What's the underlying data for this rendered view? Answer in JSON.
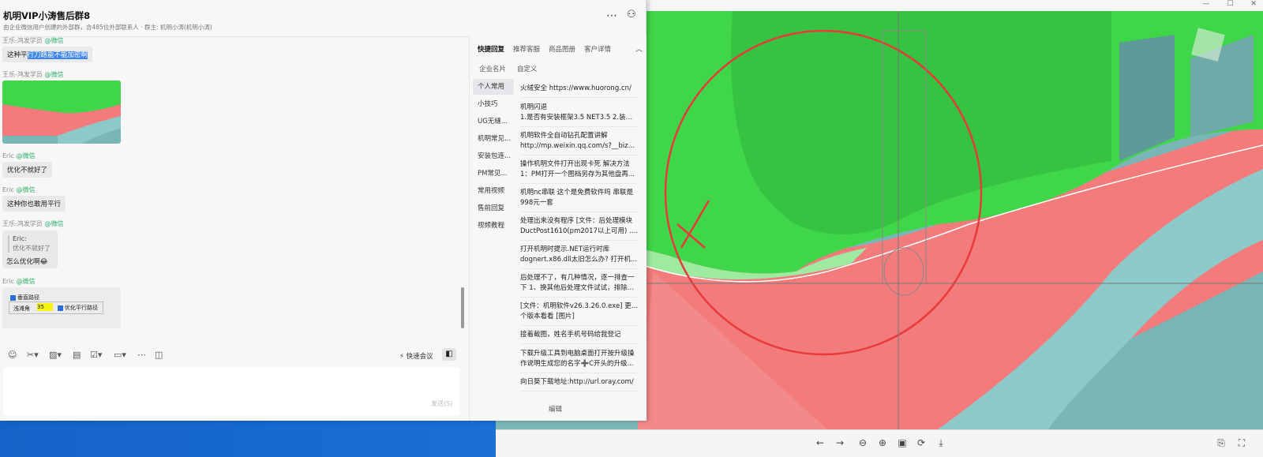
{
  "chat": {
    "title": "机明VIP小涛售后群8",
    "subtitle": "由企业微信用户创建的外部群，含485位外部联系人 · 群主: 机明小涛(机明小涛)",
    "messages": [
      {
        "sender": "王乐-鸿发学员",
        "source": "@微信",
        "text_pre": "这种平",
        "text_hl": "行刀路能不能加密啊"
      },
      {
        "sender": "王乐-鸿发学员",
        "source": "@微信",
        "type": "image"
      },
      {
        "sender": "Eric",
        "source": "@微信",
        "text": "优化不就好了"
      },
      {
        "sender": "Eric",
        "source": "@微信",
        "text": "这种你也敢用平行"
      },
      {
        "sender": "王乐-鸿发学员",
        "source": "@微信",
        "quote_name": "Eric:",
        "quote_text": "优化不就好了",
        "text": "怎么优化啊😂"
      },
      {
        "sender": "Eric",
        "source": "@微信",
        "type": "image",
        "img": {
          "check1": "垂直路径",
          "label": "浅滩角",
          "value": "35",
          "check2": "优化平行路径"
        }
      }
    ],
    "toolbar": {
      "quick_meeting": "快速会议"
    },
    "send_label": "发送(S)"
  },
  "panel": {
    "tabs": [
      "快捷回复",
      "推荐客服",
      "商品图册",
      "客户详情"
    ],
    "subtabs": [
      "企业名片",
      "自定义"
    ],
    "categories": [
      "个人常用",
      "小技巧",
      "UG无缝...",
      "机明常见...",
      "安装包连...",
      "PM常见...",
      "常用视频",
      "售前回复",
      "视频教程"
    ],
    "replies": [
      [
        "火绒安全  https://www.huorong.cn/"
      ],
      [
        "机明闪退",
        "1.是否有安装框架3.5 NET3.5 2.装了要..."
      ],
      [
        "机明软件全自动钻孔配置讲解",
        "http://mp.weixin.qq.com/s?__biz=..."
      ],
      [
        "操作机明文件打开出现卡死 解决方法",
        "1：PM打开一个图档另存为其他盘再..."
      ],
      [
        "机明nc串联 这个是免费软件吗 串联是",
        "998元一套"
      ],
      [
        "处理出来没有程序 [文件：后处理模块",
        "DuctPost1610(pm2017以上可用) .r..."
      ],
      [
        "打开机明时提示.NET运行时库",
        "dognert.x86.dll太旧怎么办? 打开机..."
      ],
      [
        "后处理不了，有几种情况，逐一排查一",
        "下 1、换其他后处理文件试试，排除本..."
      ],
      [
        "[文件：机明软件v26.3.26.0.exe] 更新这",
        "个版本看看 [图片]"
      ],
      [
        "接着截图，姓名手机号码给我登记"
      ],
      [
        "下载升级工具到电脑桌面打开按升级操",
        "作说明生成您的名字➕C开头的升级..."
      ],
      [
        "向日葵下载地址:http://url.oray.com/"
      ]
    ],
    "edit_label": "编辑"
  },
  "colors": {
    "accent": "#3e86e8",
    "wechat": "#2aae67",
    "cad_green": "#3fd64a",
    "cad_red": "#f47b7b",
    "cad_teal": "#79b8b8"
  }
}
